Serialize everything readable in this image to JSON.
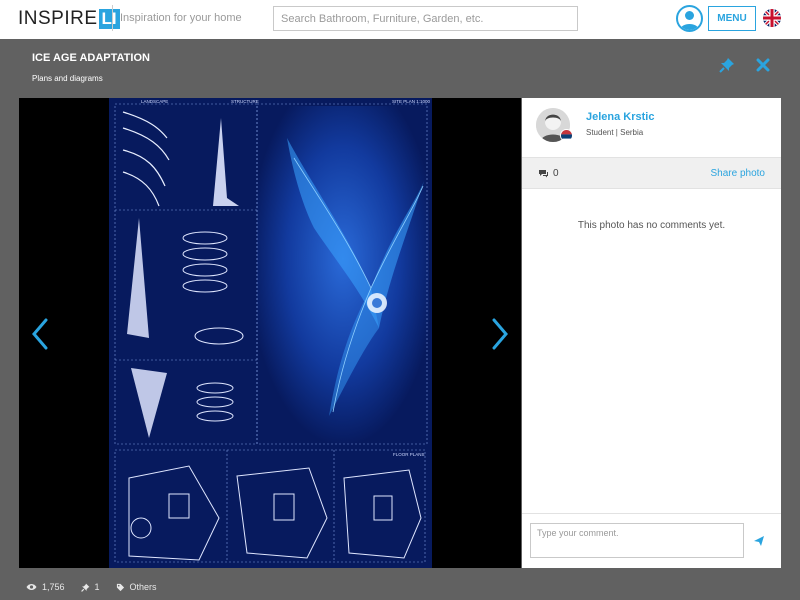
{
  "header": {
    "logo_text": "INSPIRE",
    "logo_box": "LI",
    "tagline": "Inspiration for your home",
    "search_placeholder": "Search Bathroom, Furniture, Garden, etc.",
    "menu_label": "MENU",
    "accent_color": "#2aa4df"
  },
  "photo": {
    "title": "ICE AGE ADAPTATION",
    "subtitle": "Plans and diagrams"
  },
  "author": {
    "name": "Jelena Krstic",
    "meta": "Student | Serbia"
  },
  "comments": {
    "count": "0",
    "share_label": "Share photo",
    "empty_text": "This photo has no comments yet.",
    "input_placeholder": "Type your comment."
  },
  "stats": {
    "views": "1,756",
    "pins": "1",
    "category": "Others"
  },
  "plan_labels": {
    "landscape": "LANDSCAPE",
    "structure": "STRUCTURE",
    "site_plan": "SITE PLAN 1:1000",
    "floor_plans": "FLOOR PLANS"
  }
}
